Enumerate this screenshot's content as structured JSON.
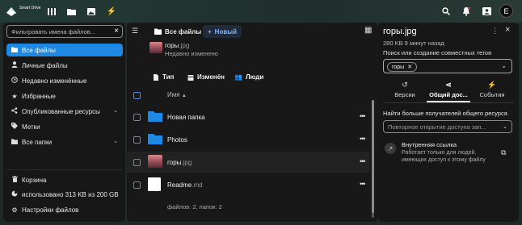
{
  "app": {
    "name": "Smart Drive",
    "topbar_icons": [
      "dashboard-icon",
      "files-icon",
      "photos-icon",
      "activity-icon"
    ],
    "right_icons": [
      "search-icon",
      "notifications-icon",
      "contacts-icon"
    ],
    "avatar_letter": "E"
  },
  "sidebar": {
    "filter_placeholder": "Фильтровать имена файлов...",
    "items": [
      {
        "label": "Все файлы",
        "icon": "folder-icon",
        "active": true
      },
      {
        "label": "Личные файлы",
        "icon": "user-icon"
      },
      {
        "label": "Недавно изменённые",
        "icon": "clock-icon"
      },
      {
        "label": "Избранные",
        "icon": "star-icon"
      },
      {
        "label": "Опубликованные ресурсы",
        "icon": "share-icon",
        "expandable": true
      },
      {
        "label": "Метки",
        "icon": "tag-icon"
      },
      {
        "label": "Все папки",
        "icon": "folder-icon",
        "expandable": true
      }
    ],
    "bottom": {
      "trash": "Корзина",
      "usage": "использовано 313 KB из 200 GB",
      "settings": "Настройки файлов"
    }
  },
  "main": {
    "breadcrumb": "Все файлы",
    "new_button": "Новый",
    "recent": {
      "name": "горы",
      "ext": ".jpg",
      "subtitle": "Недавно изменено"
    },
    "filters": {
      "type": "Тип",
      "modified": "Изменён",
      "people": "Люди"
    },
    "column_name": "Имя",
    "rows": [
      {
        "name": "Новая папка",
        "ext": "",
        "kind": "folder"
      },
      {
        "name": "Photos",
        "ext": "",
        "kind": "folder"
      },
      {
        "name": "горы",
        "ext": ".jpg",
        "kind": "image"
      },
      {
        "name": "Readme",
        "ext": ".md",
        "kind": "doc"
      }
    ],
    "footer": "файлов: 2, папок: 2"
  },
  "details": {
    "title": "горы.jpg",
    "subtitle": "280 KB 9 минут назад",
    "tags_label": "Поиск или создание совместных тегов",
    "tag": "горы",
    "tabs": [
      {
        "label": "Версии",
        "icon": "history-icon"
      },
      {
        "label": "Общий дос...",
        "icon": "share-icon",
        "active": true
      },
      {
        "label": "События",
        "icon": "activity-icon"
      }
    ],
    "share_label": "Найти больше получателей общего ресурса",
    "share_placeholder": "Повторное открытие доступа зап...",
    "internal_link_title": "Внутренняя ссылка",
    "internal_link_desc": "Работает только для людей, имеющих доступ к этому файлу"
  },
  "colors": {
    "accent": "#1e88e5",
    "background": "#171717",
    "topbar": "#233a35"
  }
}
